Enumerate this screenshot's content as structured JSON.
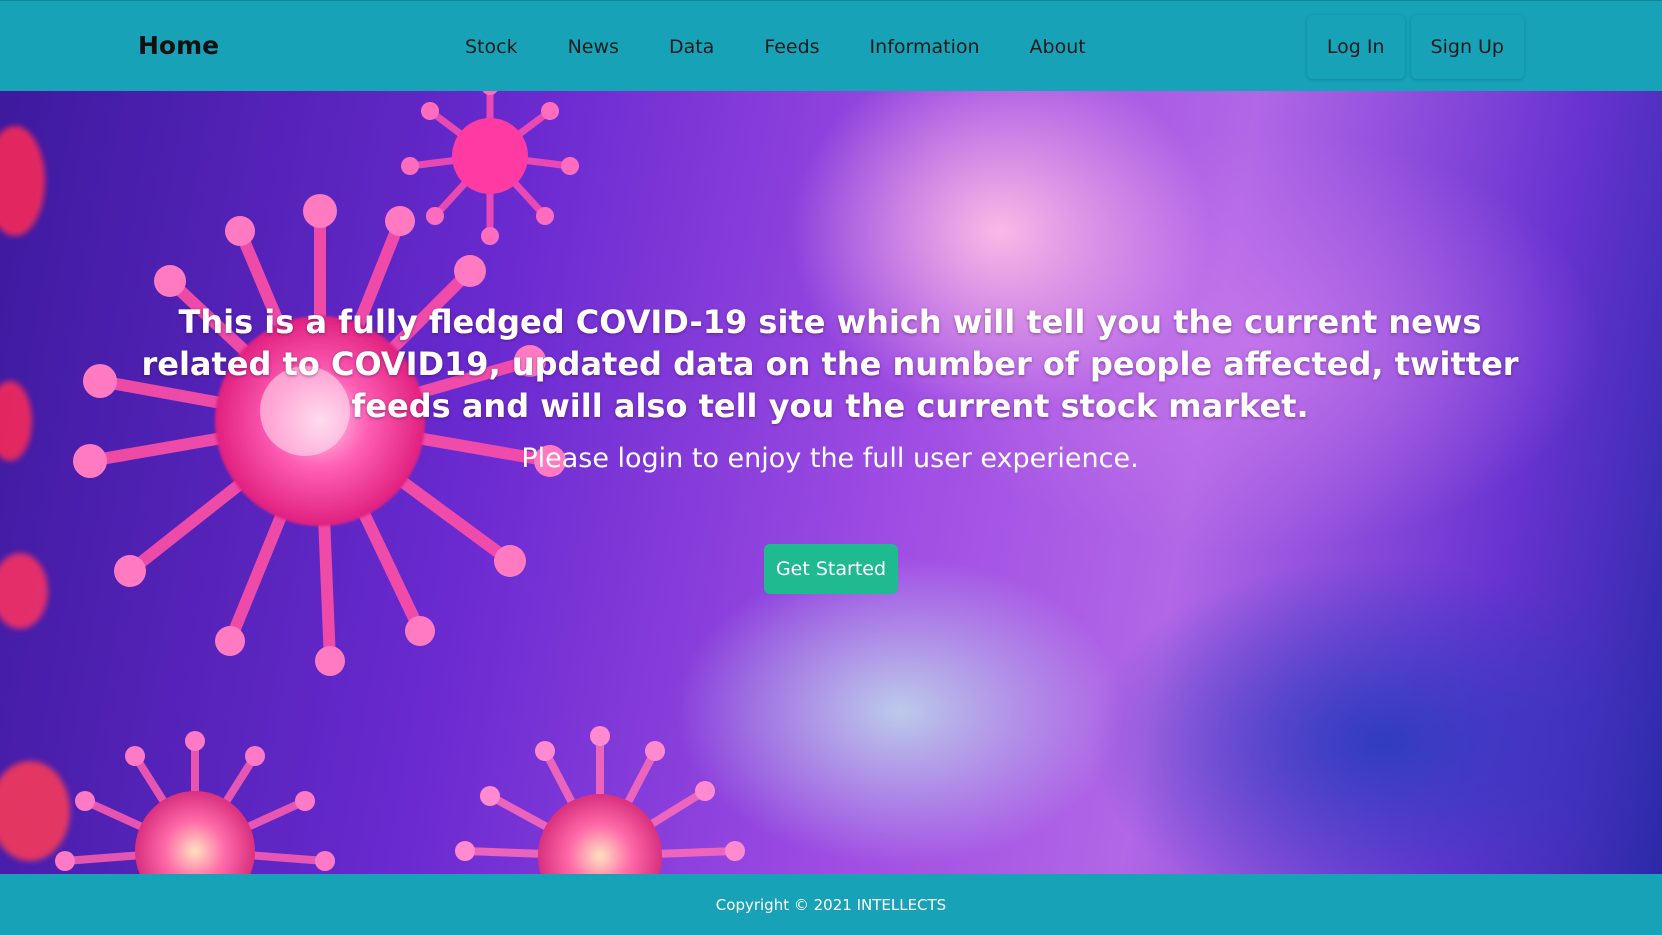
{
  "navbar": {
    "brand": "Home",
    "links": [
      "Stock",
      "News",
      "Data",
      "Feeds",
      "Information",
      "About"
    ],
    "login_label": "Log In",
    "signup_label": "Sign Up",
    "background_color": "#17a2b8"
  },
  "hero": {
    "title": "This is a fully fledged COVID-19 site which will tell you the current news related to COVID19, updated data on the number of people affected, twitter feeds and will also tell you the current stock market.",
    "subtitle": "Please login to enjoy the full user experience.",
    "cta_label": "Get Started",
    "cta_color": "#1fba8f",
    "background_image": "virus-particles"
  },
  "footer": {
    "copyright": "Copyright © 2021 INTELLECTS"
  }
}
